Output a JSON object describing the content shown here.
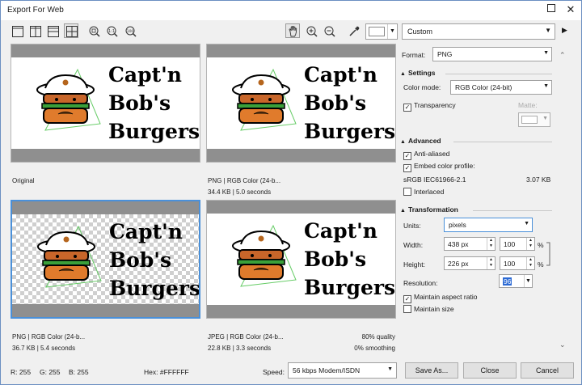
{
  "window": {
    "title": "Export For Web"
  },
  "toolbar": {
    "icons": [
      "single-view-icon",
      "split-vertical-icon",
      "split-horizontal-icon",
      "quad-view-icon",
      "zoom-fit-icon",
      "zoom-1to1-icon",
      "zoom-100-icon",
      "pan-hand-icon",
      "zoom-in-icon",
      "zoom-out-icon",
      "eyedropper-icon"
    ],
    "preset": "Custom"
  },
  "previews": [
    {
      "text_lines": [
        "Capt'n",
        "Bob's",
        "Burgers"
      ],
      "caption_left_1": "Original",
      "caption_left_2": "",
      "caption_right_1": "",
      "caption_right_2": ""
    },
    {
      "text_lines": [
        "Capt'n",
        "Bob's",
        "Burgers"
      ],
      "caption_left_1": "PNG  |  RGB Color (24-b...",
      "caption_left_2": "34.4 KB  |  5.0 seconds",
      "caption_right_1": "",
      "caption_right_2": ""
    },
    {
      "text_lines": [
        "Capt'n",
        "Bob's",
        "Burgers"
      ],
      "caption_left_1": "PNG  |  RGB Color (24-b...",
      "caption_left_2": "36.7 KB  |  5.4 seconds",
      "caption_right_1": "",
      "caption_right_2": ""
    },
    {
      "text_lines": [
        "Capt'n",
        "Bob's",
        "Burgers"
      ],
      "caption_left_1": "JPEG  |  RGB Color (24-b...",
      "caption_left_2": "22.8 KB  |  3.3 seconds",
      "caption_right_1": "80% quality",
      "caption_right_2": "0% smoothing"
    }
  ],
  "panel": {
    "format_label": "Format:",
    "format_value": "PNG",
    "settings_title": "Settings",
    "color_mode_label": "Color mode:",
    "color_mode_value": "RGB Color (24-bit)",
    "transparency_label": "Transparency",
    "transparency_checked": true,
    "matte_label": "Matte:",
    "advanced_title": "Advanced",
    "anti_aliased_label": "Anti-aliased",
    "anti_aliased_checked": true,
    "embed_profile_label": "Embed color profile:",
    "embed_profile_checked": true,
    "profile_name": "sRGB IEC61966-2.1",
    "profile_size": "3.07 KB",
    "interlaced_label": "Interlaced",
    "interlaced_checked": false,
    "transformation_title": "Transformation",
    "units_label": "Units:",
    "units_value": "pixels",
    "width_label": "Width:",
    "width_value": "438 px",
    "width_pct": "100",
    "height_label": "Height:",
    "height_value": "226 px",
    "height_pct": "100",
    "pct_sign": "%",
    "resolution_label": "Resolution:",
    "resolution_value": "96",
    "maintain_aspect_label": "Maintain aspect ratio",
    "maintain_aspect_checked": true,
    "maintain_size_label": "Maintain size",
    "maintain_size_checked": false
  },
  "status": {
    "r": "R: 255",
    "g": "G: 255",
    "b": "B: 255",
    "hex": "Hex: #FFFFFF",
    "speed_label": "Speed:",
    "speed_value": "56 kbps Modem/ISDN"
  },
  "buttons": {
    "save_as": "Save As...",
    "close": "Close",
    "cancel": "Cancel"
  },
  "colors": {
    "accent": "#4a90d9",
    "selection": "#2c6ad4"
  }
}
